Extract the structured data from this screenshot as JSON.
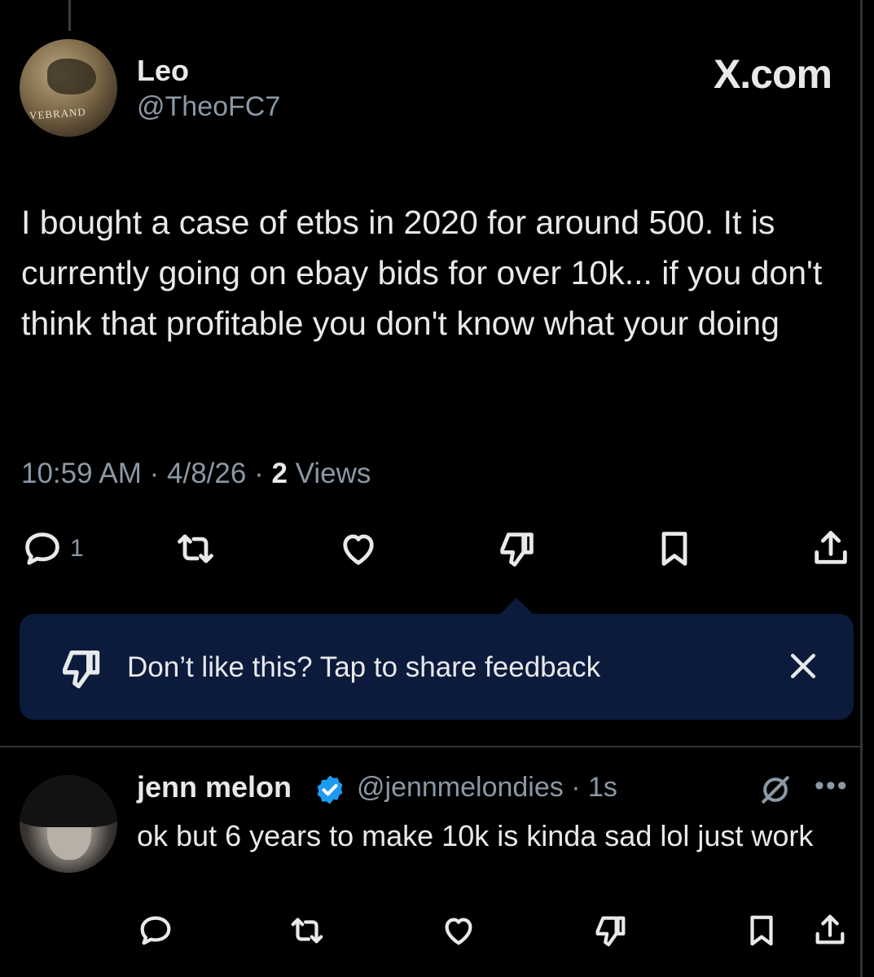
{
  "tweet": {
    "author_name": "Leo",
    "author_handle": "@TheoFC7",
    "avatar_text": "VEBRAND",
    "brand": "X.com",
    "text": "I bought a case of etbs in 2020 for around 500. It is currently going on ebay bids for over 10k... if you don't think that profitable you don't know what your doing",
    "time": "10:59 AM",
    "date": "4/8/26",
    "views_count": "2",
    "views_label": "Views",
    "reply_count": "1"
  },
  "feedback": {
    "text": "Don’t like this? Tap to share feedback",
    "close_icon": "close-icon"
  },
  "reply": {
    "author_name": "jenn melon",
    "author_handle": "@jennmelondies",
    "time": "1s",
    "verified": true,
    "verified_color": "#1d9bf0",
    "text": "ok but 6 years to make 10k is kinda sad lol just work"
  },
  "icons": {
    "reply": "reply-icon",
    "repost": "repost-icon",
    "like": "heart-icon",
    "dislike": "dislike-icon",
    "bookmark": "bookmark-icon",
    "share": "share-icon",
    "grok": "grok-icon",
    "more": "more-icon"
  },
  "colors": {
    "background": "#000000",
    "text": "#e7e9ea",
    "muted": "#8b98a5",
    "feedback_bg": "#0c1b3c",
    "verified": "#1d9bf0"
  }
}
